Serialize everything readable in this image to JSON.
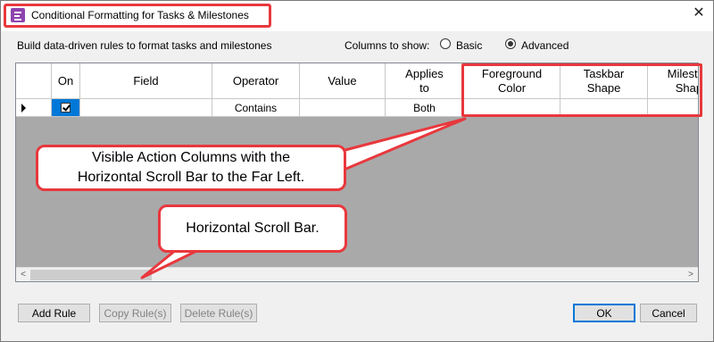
{
  "window": {
    "title": "Conditional Formatting for Tasks & Milestones",
    "close_glyph": "✕",
    "icon": "conditional-formatting-icon"
  },
  "subtitle": "Build data-driven rules to format tasks and milestones",
  "columns_to_show": {
    "label": "Columns to show:",
    "options": [
      "Basic",
      "Advanced"
    ],
    "selected": "Advanced"
  },
  "grid": {
    "headers": {
      "on": "On",
      "field": "Field",
      "operator": "Operator",
      "value": "Value",
      "applies_to": "Applies\nto",
      "foreground_color": "Foreground\nColor",
      "taskbar_shape": "Taskbar\nShape",
      "milestone_shape": "Milestone\nShape"
    },
    "rows": [
      {
        "on": true,
        "field": "",
        "operator": "Contains",
        "value": "",
        "applies_to": "Both",
        "foreground_color": "",
        "taskbar_shape": "",
        "milestone_shape": ""
      }
    ]
  },
  "scrollbar": {
    "left_arrow": "<",
    "right_arrow": ">"
  },
  "callouts": {
    "action_columns": "Visible Action Columns with the\nHorizontal Scroll Bar to the Far Left.",
    "scroll_bar": "Horizontal Scroll Bar."
  },
  "buttons": {
    "add_rule": "Add Rule",
    "copy_rules": "Copy Rule(s)",
    "delete_rules": "Delete Rule(s)",
    "ok": "OK",
    "cancel": "Cancel"
  },
  "colors": {
    "annotation": "#e8383d",
    "grid_background": "#a9a9a9",
    "selection": "#0078d7"
  }
}
